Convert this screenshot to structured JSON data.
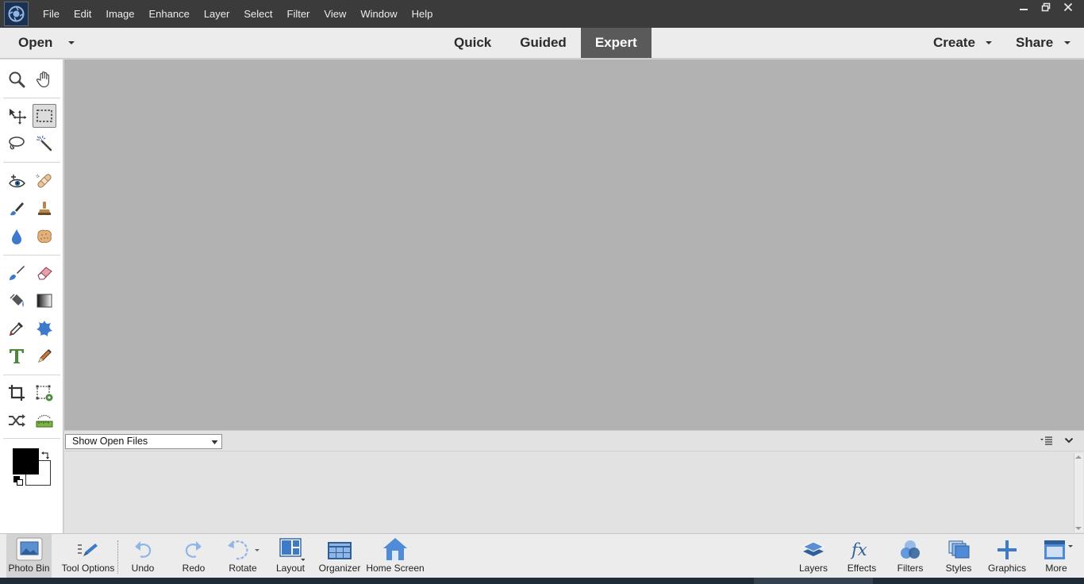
{
  "menu": [
    "File",
    "Edit",
    "Image",
    "Enhance",
    "Layer",
    "Select",
    "Filter",
    "View",
    "Window",
    "Help"
  ],
  "modebar": {
    "open_label": "Open",
    "tabs": [
      {
        "label": "Quick",
        "active": false
      },
      {
        "label": "Guided",
        "active": false
      },
      {
        "label": "Expert",
        "active": true
      }
    ],
    "create_label": "Create",
    "share_label": "Share"
  },
  "toolbox": {
    "selected_tool": "rectangular-marquee-tool",
    "foreground_color": "#000000",
    "background_color": "#ffffff"
  },
  "bin": {
    "select_value": "Show Open Files"
  },
  "taskbar": {
    "photo_bin": "Photo Bin",
    "tool_options": "Tool Options",
    "undo": "Undo",
    "redo": "Redo",
    "rotate": "Rotate",
    "layout": "Layout",
    "organizer": "Organizer",
    "home_screen": "Home Screen",
    "layers": "Layers",
    "effects": "Effects",
    "filters": "Filters",
    "styles": "Styles",
    "graphics": "Graphics",
    "more": "More"
  },
  "colors": {
    "title_bar": "#3b3b3b",
    "canvas": "#b2b2b2",
    "active_tab": "#5a5a5a",
    "accent_blue": "#3d7ac9"
  }
}
